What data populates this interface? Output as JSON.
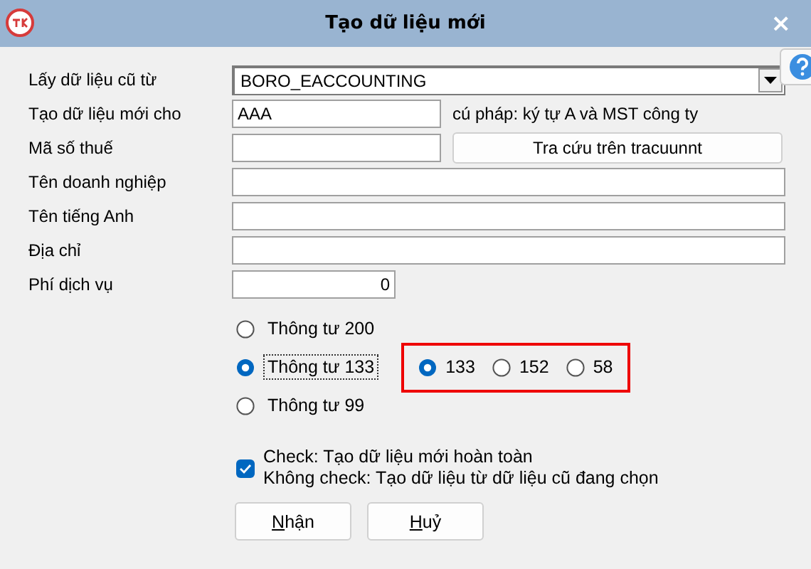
{
  "window": {
    "title": "Tạo dữ liệu mới",
    "close": "×"
  },
  "fields": [
    {
      "kind": "dropdown",
      "label": "Lấy dữ liệu cũ từ",
      "value": "BORO_EACCOUNTING"
    },
    {
      "kind": "hint",
      "label": "Tạo dữ liệu mới cho",
      "value": "AAA",
      "hint": "cú pháp: ký tự A và MST công ty"
    },
    {
      "kind": "lookup",
      "label": "Mã số thuế",
      "button": "Tra cứu trên tracuunnt"
    },
    {
      "kind": "text",
      "label": "Tên doanh nghiệp"
    },
    {
      "kind": "text",
      "label": "Tên tiếng Anh"
    },
    {
      "kind": "text",
      "label": "Địa chỉ"
    },
    {
      "kind": "number",
      "label": "Phí dịch vụ",
      "value": "0"
    }
  ],
  "circulars": [
    {
      "label": "Thông tư 200",
      "selected": false,
      "focused": false
    },
    {
      "label": "Thông tư 133",
      "selected": true,
      "focused": true,
      "options": [
        {
          "label": "133",
          "selected": true
        },
        {
          "label": "152",
          "selected": false
        },
        {
          "label": "58",
          "selected": false
        }
      ]
    },
    {
      "label": "Thông tư 99",
      "selected": false,
      "focused": false
    }
  ],
  "new_data": {
    "checked": true,
    "lines": [
      "Check: Tạo dữ liệu mới hoàn toàn",
      "Không check: Tạo dữ liệu từ dữ liệu cũ đang chọn"
    ]
  },
  "buttons": [
    "Nhận",
    "Huỷ"
  ]
}
